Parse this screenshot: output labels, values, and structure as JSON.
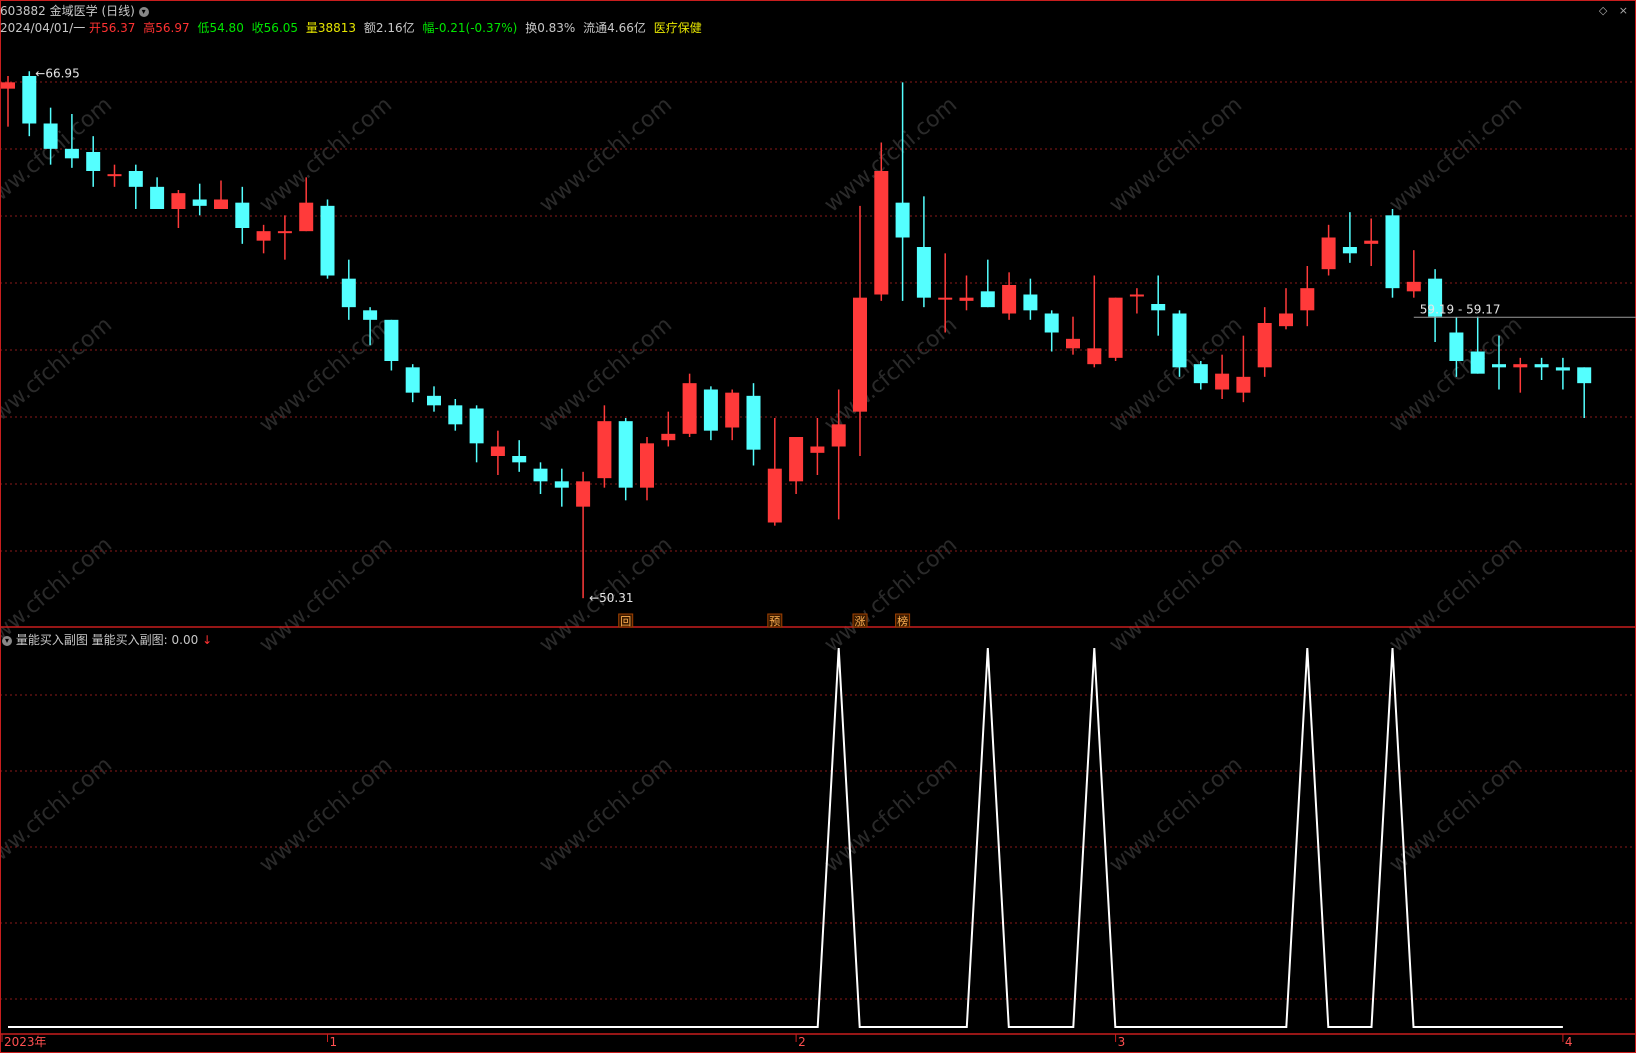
{
  "header": {
    "code": "603882",
    "name": "金域医学",
    "period": "(日线)",
    "date": "2024/04/01/一",
    "open_label": "开",
    "open": "56.37",
    "high_label": "高",
    "high": "56.97",
    "low_label": "低",
    "low": "54.80",
    "close_label": "收",
    "close": "56.05",
    "vol_label": "量",
    "vol": "38813",
    "amount_label": "额",
    "amount": "2.16亿",
    "change_label": "幅",
    "change": "-0.21(-0.37%)",
    "turnover_label": "换",
    "turnover": "0.83%",
    "float_label": "流通",
    "float": "4.66亿",
    "sector": "医疗保健"
  },
  "subchart": {
    "title": "量能买入副图",
    "indicator": "量能买入副图: 0.00"
  },
  "corner_icons": [
    "◇",
    "×"
  ],
  "watermark": "www.cfchi.com",
  "colors": {
    "up": "#ff3a3a",
    "down": "#54ffff",
    "grid": "#8a1a1a",
    "border": "#c81e1e",
    "line": "#ffffff"
  },
  "chart_data": [
    {
      "type": "candlestick",
      "ylim": [
        50.0,
        68.0
      ],
      "annotations": [
        {
          "label": "66.95",
          "value": 66.95,
          "index": 1
        },
        {
          "label": "50.31",
          "value": 50.31,
          "index": 27
        },
        {
          "label": "59.19 - 59.17",
          "value": 59.18,
          "index": 66
        }
      ],
      "markers": [
        {
          "label": "回",
          "index": 29
        },
        {
          "label": "预",
          "index": 36
        },
        {
          "label": "涨",
          "index": 40
        },
        {
          "label": "榜",
          "index": 42
        }
      ],
      "x_axis_labels": [
        {
          "label": "2023年",
          "index": 0
        },
        {
          "label": "1",
          "index": 15
        },
        {
          "label": "2",
          "index": 37
        },
        {
          "label": "3",
          "index": 52
        },
        {
          "label": "4",
          "index": 73
        }
      ],
      "candles": [
        [
          66.4,
          66.6,
          65.2,
          66.8
        ],
        [
          66.8,
          65.3,
          64.9,
          66.95
        ],
        [
          65.3,
          64.5,
          64.0,
          65.8
        ],
        [
          64.5,
          64.2,
          63.9,
          65.6
        ],
        [
          64.4,
          63.8,
          63.3,
          64.9
        ],
        [
          63.7,
          63.7,
          63.3,
          64.0
        ],
        [
          63.8,
          63.3,
          62.6,
          64.0
        ],
        [
          63.3,
          62.6,
          62.6,
          63.6
        ],
        [
          62.6,
          63.1,
          62.0,
          63.2
        ],
        [
          62.9,
          62.7,
          62.4,
          63.4
        ],
        [
          62.6,
          62.9,
          62.6,
          63.5
        ],
        [
          62.8,
          62.0,
          61.5,
          63.3
        ],
        [
          61.6,
          61.9,
          61.2,
          62.1
        ],
        [
          61.9,
          61.9,
          61.0,
          62.4
        ],
        [
          61.9,
          62.8,
          61.9,
          63.6
        ],
        [
          62.7,
          60.5,
          60.4,
          62.9
        ],
        [
          60.4,
          59.5,
          59.1,
          61.0
        ],
        [
          59.4,
          59.1,
          58.3,
          59.5
        ],
        [
          59.1,
          57.8,
          57.5,
          59.1
        ],
        [
          57.6,
          56.8,
          56.5,
          57.7
        ],
        [
          56.7,
          56.4,
          56.2,
          57.0
        ],
        [
          56.4,
          55.8,
          55.6,
          56.6
        ],
        [
          56.3,
          55.2,
          54.6,
          56.4
        ],
        [
          54.8,
          55.1,
          54.2,
          55.6
        ],
        [
          54.8,
          54.6,
          54.3,
          55.3
        ],
        [
          54.4,
          54.0,
          53.6,
          54.6
        ],
        [
          54.0,
          53.8,
          53.2,
          54.4
        ],
        [
          53.2,
          54.0,
          50.31,
          54.3
        ],
        [
          54.1,
          55.9,
          53.8,
          56.4
        ],
        [
          55.9,
          53.8,
          53.4,
          56.0
        ],
        [
          53.8,
          55.2,
          53.4,
          55.4
        ],
        [
          55.3,
          55.5,
          55.1,
          56.2
        ],
        [
          55.5,
          57.1,
          55.4,
          57.4
        ],
        [
          56.9,
          55.6,
          55.3,
          57.0
        ],
        [
          55.7,
          56.8,
          55.3,
          56.9
        ],
        [
          56.7,
          55.0,
          54.5,
          57.1
        ],
        [
          52.7,
          54.4,
          52.6,
          56.0
        ],
        [
          54.0,
          55.4,
          53.6,
          55.4
        ],
        [
          54.9,
          55.1,
          54.2,
          56.0
        ],
        [
          55.1,
          55.8,
          52.8,
          56.9
        ],
        [
          56.2,
          59.8,
          54.8,
          62.7
        ],
        [
          59.9,
          63.8,
          59.7,
          64.7
        ],
        [
          62.8,
          61.7,
          59.7,
          66.6
        ],
        [
          61.4,
          59.8,
          59.5,
          63.0
        ],
        [
          59.8,
          59.8,
          58.7,
          61.2
        ],
        [
          59.7,
          59.8,
          59.4,
          60.5
        ],
        [
          60.0,
          59.5,
          59.5,
          61.0
        ],
        [
          59.3,
          60.2,
          59.1,
          60.6
        ],
        [
          59.9,
          59.4,
          59.1,
          60.4
        ],
        [
          59.3,
          58.7,
          58.1,
          59.4
        ],
        [
          58.2,
          58.5,
          58.0,
          59.2
        ],
        [
          57.7,
          58.2,
          57.6,
          60.5
        ],
        [
          57.9,
          59.8,
          57.8,
          59.8
        ],
        [
          59.9,
          59.9,
          59.3,
          60.1
        ],
        [
          59.6,
          59.4,
          58.6,
          60.5
        ],
        [
          59.3,
          57.6,
          57.3,
          59.4
        ],
        [
          57.7,
          57.1,
          56.9,
          57.8
        ],
        [
          56.9,
          57.4,
          56.6,
          58.0
        ],
        [
          56.8,
          57.3,
          56.5,
          58.6
        ],
        [
          57.6,
          59.0,
          57.3,
          59.5
        ],
        [
          58.9,
          59.3,
          58.8,
          60.1
        ],
        [
          59.4,
          60.1,
          58.9,
          60.8
        ],
        [
          60.7,
          61.7,
          60.5,
          62.1
        ],
        [
          61.4,
          61.2,
          60.9,
          62.5
        ],
        [
          61.5,
          61.6,
          60.8,
          62.3
        ],
        [
          62.4,
          60.1,
          59.8,
          62.6
        ],
        [
          60.0,
          60.3,
          59.8,
          61.3
        ],
        [
          60.4,
          59.2,
          58.4,
          60.7
        ],
        [
          58.7,
          57.8,
          57.3,
          59.19
        ],
        [
          58.1,
          57.4,
          57.4,
          59.2
        ],
        [
          57.7,
          57.6,
          56.9,
          58.6
        ],
        [
          57.6,
          57.7,
          56.8,
          57.9
        ],
        [
          57.7,
          57.6,
          57.2,
          57.9
        ],
        [
          57.6,
          57.5,
          56.9,
          57.9
        ],
        [
          57.6,
          57.1,
          56.0,
          57.6
        ]
      ]
    },
    {
      "type": "line",
      "name": "量能买入副图",
      "ylim": [
        0,
        1
      ],
      "x": [
        0,
        1,
        2,
        3,
        4,
        5,
        6,
        7,
        8,
        9,
        10,
        11,
        12,
        13,
        14,
        15,
        16,
        17,
        18,
        19,
        20,
        21,
        22,
        23,
        24,
        25,
        26,
        27,
        28,
        29,
        30,
        31,
        32,
        33,
        34,
        35,
        36,
        37,
        38,
        39,
        40,
        41,
        42,
        43,
        44,
        45,
        46,
        47,
        48,
        49,
        50,
        51,
        52,
        53,
        54,
        55,
        56,
        57,
        58,
        59,
        60,
        61,
        62,
        63,
        64,
        65,
        66,
        67,
        68,
        69,
        70,
        71,
        72,
        73
      ],
      "values": [
        0,
        0,
        0,
        0,
        0,
        0,
        0,
        0,
        0,
        0,
        0,
        0,
        0,
        0,
        0,
        0,
        0,
        0,
        0,
        0,
        0,
        0,
        0,
        0,
        0,
        0,
        0,
        0,
        0,
        0,
        0,
        0,
        0,
        0,
        0,
        0,
        0,
        0,
        0,
        1,
        0,
        0,
        0,
        0,
        0,
        0,
        1,
        0,
        0,
        0,
        0,
        1,
        0,
        0,
        0,
        0,
        0,
        0,
        0,
        0,
        0,
        1,
        0,
        0,
        0,
        1,
        0,
        0,
        0,
        0,
        0,
        0,
        0,
        0
      ]
    }
  ]
}
